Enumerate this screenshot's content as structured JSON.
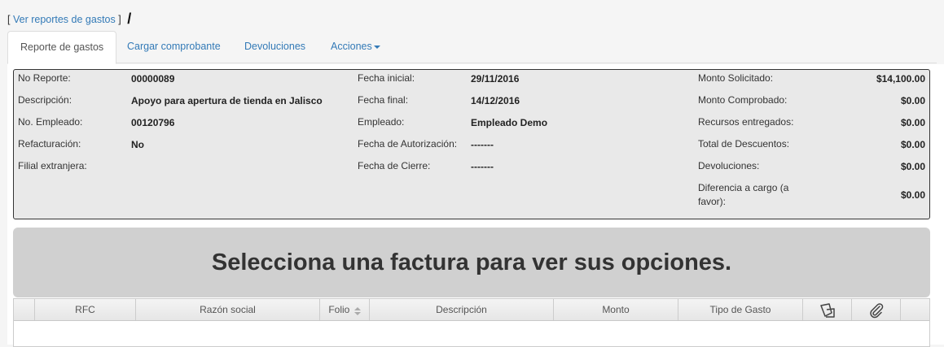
{
  "breadcrumb": {
    "bracket_open": "[",
    "link": "Ver reportes de gastos",
    "bracket_close": "]",
    "separator": "/"
  },
  "tabs": [
    {
      "label": "Reporte de gastos",
      "active": true
    },
    {
      "label": "Cargar comprobante",
      "active": false
    },
    {
      "label": "Devoluciones",
      "active": false
    },
    {
      "label": "Acciones",
      "active": false,
      "dropdown": true
    }
  ],
  "summary": {
    "col1": [
      {
        "label": "No Reporte:",
        "value": "00000089"
      },
      {
        "label": "Descripción:",
        "value": "Apoyo para apertura de tienda en Jalisco"
      },
      {
        "label": "No. Empleado:",
        "value": "00120796"
      },
      {
        "label": "Refacturación:",
        "value": "No"
      },
      {
        "label": "Filial extranjera:",
        "value": ""
      }
    ],
    "col2": [
      {
        "label": "Fecha inicial:",
        "value": "29/11/2016"
      },
      {
        "label": "Fecha final:",
        "value": "14/12/2016"
      },
      {
        "label": "Empleado:",
        "value": "Empleado Demo"
      },
      {
        "label": "Fecha de Autorización:",
        "value": "-------"
      },
      {
        "label": "Fecha de Cierre:",
        "value": "-------"
      }
    ],
    "col3": [
      {
        "label": "Monto Solicitado:",
        "value": "$14,100.00"
      },
      {
        "label": "Monto Comprobado:",
        "value": "$0.00"
      },
      {
        "label": "Recursos entregados:",
        "value": "$0.00"
      },
      {
        "label": "Total de Descuentos:",
        "value": "$0.00"
      },
      {
        "label": "Devoluciones:",
        "value": "$0.00"
      },
      {
        "label_line1": "Diferencia a cargo (a",
        "label_line2": "favor):",
        "value": "$0.00"
      }
    ]
  },
  "banner": {
    "text": "Selecciona una factura para ver sus opciones."
  },
  "grid": {
    "columns": [
      "RFC",
      "Razón social",
      "Folio",
      "Descripción",
      "Monto",
      "Tipo de Gasto"
    ],
    "icons": [
      "receipt-icon",
      "paperclip-icon",
      "sort-icon"
    ]
  },
  "colors": {
    "link": "#337ab7",
    "summary_bg": "#e9e9e9",
    "banner_bg": "#d0d0d0"
  }
}
